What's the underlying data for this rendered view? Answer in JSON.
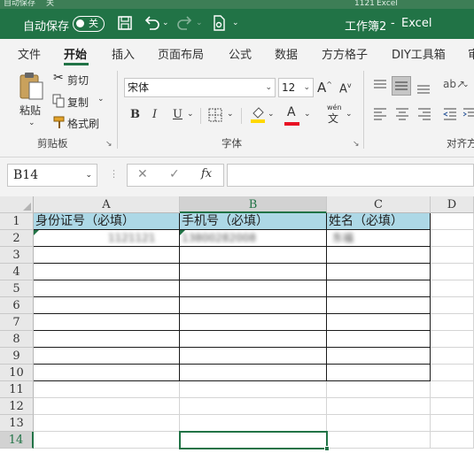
{
  "bg_window": {
    "left_text": "自动保存",
    "toggle_text": "关",
    "mid_text": "1121",
    "right_text": "Excel"
  },
  "titlebar": {
    "autosave_label": "自动保存",
    "autosave_state": "关",
    "doc_title": "工作簿2",
    "separator": "-",
    "app_name": "Excel"
  },
  "tabs": [
    {
      "label": "文件"
    },
    {
      "label": "开始"
    },
    {
      "label": "插入"
    },
    {
      "label": "页面布局"
    },
    {
      "label": "公式"
    },
    {
      "label": "数据"
    },
    {
      "label": "方方格子"
    },
    {
      "label": "DIY工具箱"
    },
    {
      "label": "审"
    }
  ],
  "active_tab": "开始",
  "ribbon": {
    "clipboard": {
      "paste_label": "粘贴",
      "cut_label": "剪切",
      "copy_label": "复制",
      "format_painter_label": "格式刷",
      "group_label": "剪贴板"
    },
    "font": {
      "font_name": "宋体",
      "font_size": "12",
      "bold": "B",
      "italic": "I",
      "underline": "U",
      "increase_size": "A",
      "decrease_size": "A",
      "wen_label": "wén",
      "wen_char": "文",
      "group_label": "字体"
    },
    "alignment": {
      "group_label": "对齐方"
    }
  },
  "formula_bar": {
    "name_box": "B14",
    "cancel": "✕",
    "enter": "✓",
    "fx": "fx",
    "content": ""
  },
  "grid": {
    "columns": [
      "A",
      "B",
      "C",
      "D"
    ],
    "selected_column": "B",
    "rows": [
      "1",
      "2",
      "3",
      "4",
      "5",
      "6",
      "7",
      "8",
      "9",
      "10",
      "11",
      "12",
      "13",
      "14"
    ],
    "selected_row": "14",
    "header_row": [
      "身份证号（必填）",
      "手机号（必填）",
      "姓名（必填）"
    ],
    "row2": [
      "1121121",
      "13800282008",
      "东福"
    ]
  },
  "colors": {
    "title_green": "#217346",
    "header_fill": "#add8e6",
    "selection": "#217346",
    "font_color_red": "#e81123",
    "highlight_yellow": "#ffd800"
  }
}
